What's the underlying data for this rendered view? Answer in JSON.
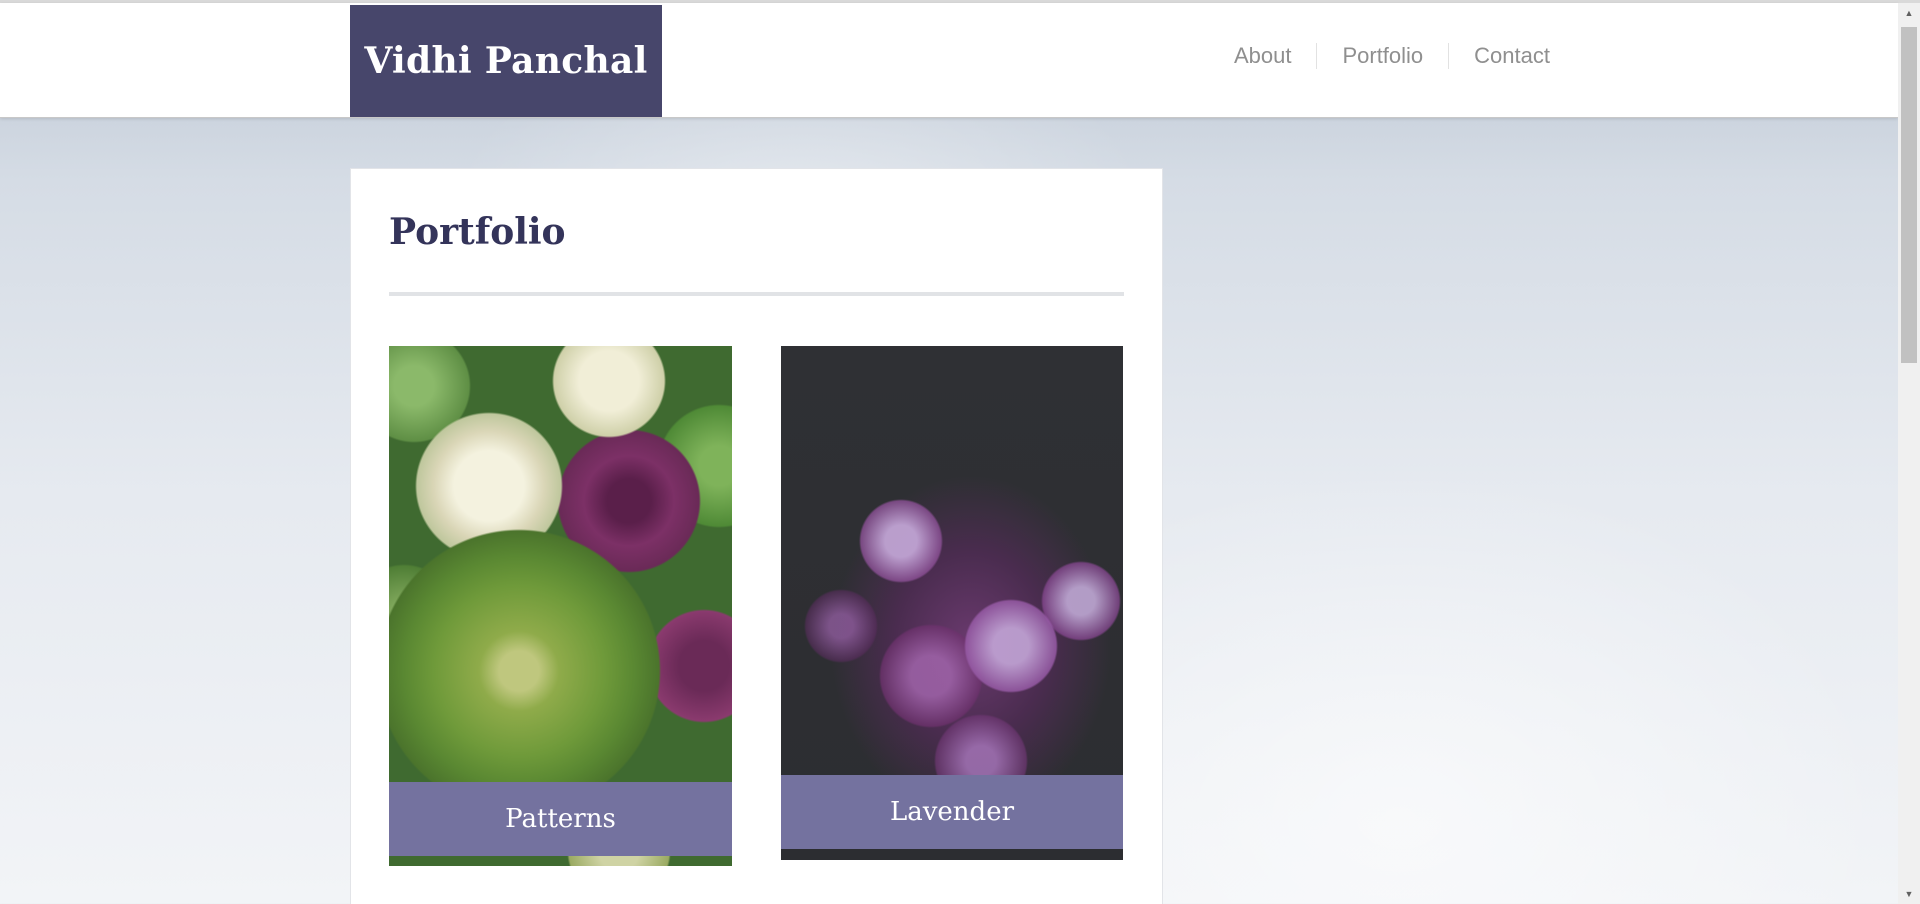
{
  "header": {
    "brand": "Vidhi Panchal",
    "nav": [
      {
        "label": "About"
      },
      {
        "label": "Portfolio"
      },
      {
        "label": "Contact"
      }
    ]
  },
  "main": {
    "title": "Portfolio",
    "cards": [
      {
        "label": "Patterns",
        "image": "ornamental-kale-photo"
      },
      {
        "label": "Lavender",
        "image": "lilac-flowers-photo"
      }
    ]
  },
  "scrollbar": {
    "up_icon": "scroll-up-arrow-icon",
    "down_icon": "scroll-down-arrow-icon"
  },
  "colors": {
    "brand_bg": "#47466b",
    "card_label_bg": "#74729f",
    "title": "#34345a",
    "nav_text": "#8f8f8f"
  }
}
